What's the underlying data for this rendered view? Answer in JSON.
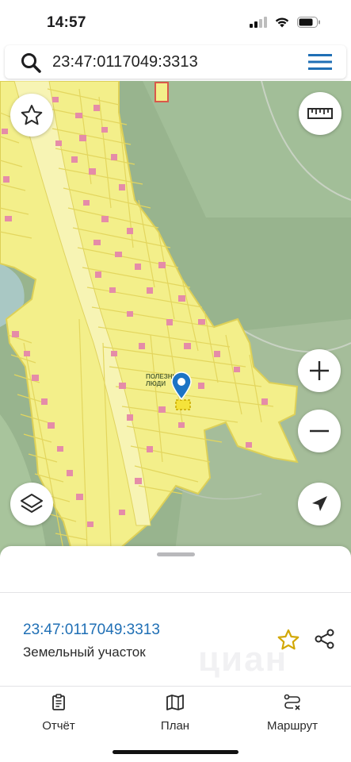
{
  "status": {
    "time": "14:57"
  },
  "search": {
    "query": "23:47:0117049:3313"
  },
  "map": {
    "poi_label": [
      "ПОЛЕЗНЫЕ",
      "ЛЮДИ"
    ]
  },
  "parcel": {
    "id": "23:47:0117049:3313",
    "type": "Земельный участок",
    "watermark": "циан"
  },
  "tabs": [
    {
      "label": "Отчёт",
      "icon": "report-icon"
    },
    {
      "label": "План",
      "icon": "map-icon"
    },
    {
      "label": "Маршрут",
      "icon": "route-icon"
    }
  ],
  "colors": {
    "accent": "#1f6fb5",
    "zone_fill": "#f3ef8a",
    "zone_outline": "#e2d45a",
    "building": "#e58ca8",
    "forest": "#98b48e",
    "star": "#d2a806",
    "pin": "#1c74c5"
  }
}
